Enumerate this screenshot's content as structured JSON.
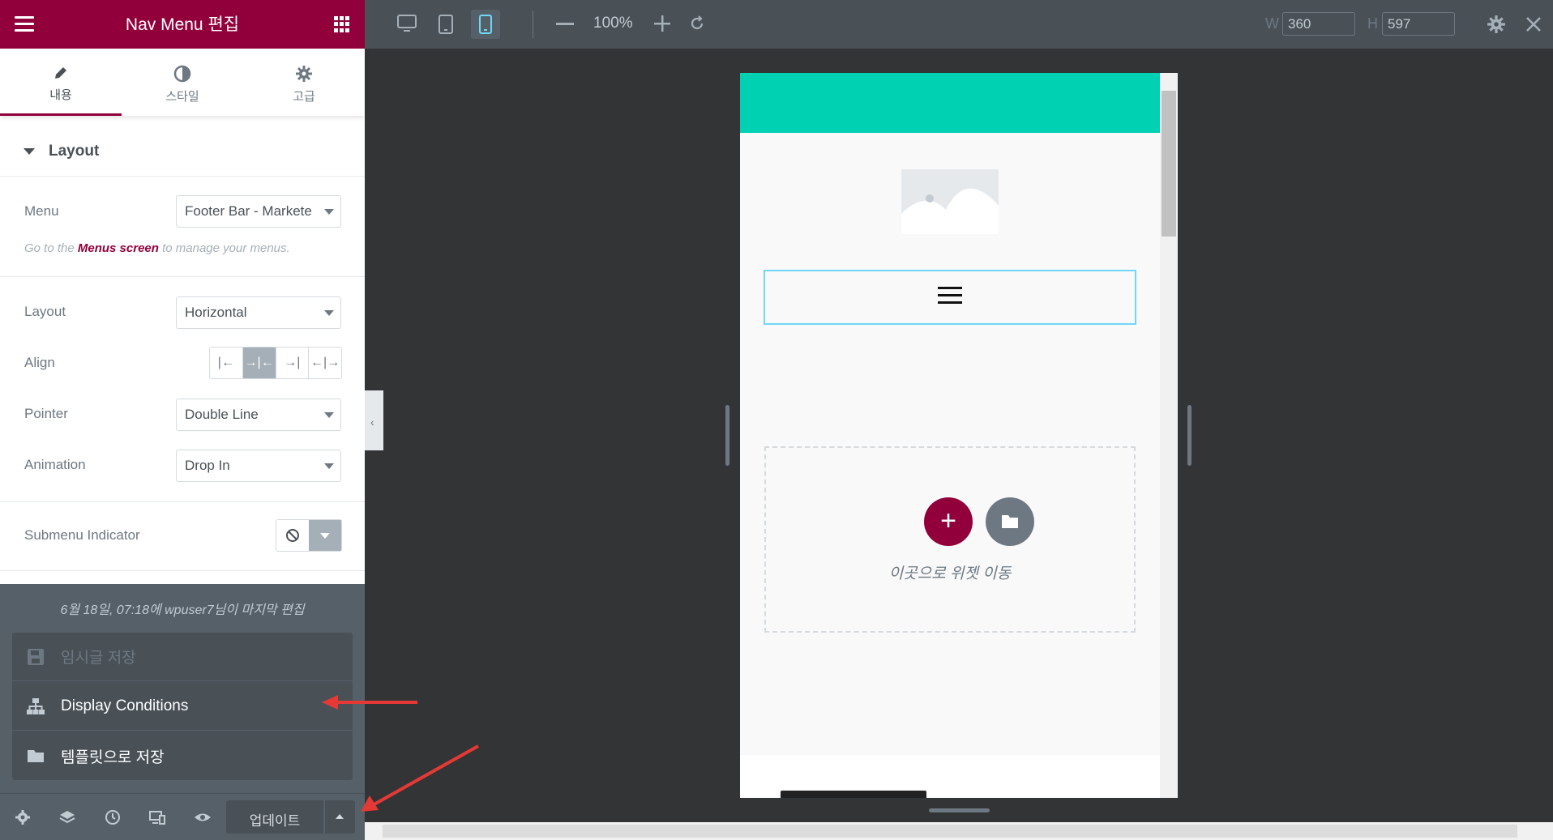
{
  "header": {
    "title": "Nav Menu 편집"
  },
  "tabs": [
    {
      "label": "내용",
      "icon": "pencil-icon",
      "active": true
    },
    {
      "label": "스타일",
      "icon": "half-circle-icon",
      "active": false
    },
    {
      "label": "고급",
      "icon": "gear-icon",
      "active": false
    }
  ],
  "section": {
    "title": "Layout"
  },
  "controls": {
    "menu": {
      "label": "Menu",
      "value": "Footer Bar - Markete"
    },
    "note": {
      "prefix": "Go to the ",
      "link": "Menus screen",
      "suffix": " to manage your menus."
    },
    "layout": {
      "label": "Layout",
      "value": "Horizontal"
    },
    "align": {
      "label": "Align",
      "options": [
        "left",
        "center",
        "right",
        "justify"
      ],
      "selected": "center"
    },
    "pointer": {
      "label": "Pointer",
      "value": "Double Line"
    },
    "animation": {
      "label": "Animation",
      "value": "Drop In"
    },
    "submenu": {
      "label": "Submenu Indicator"
    }
  },
  "popup": {
    "meta": "6월 18일, 07:18에 wpuser7님이 마지막 편집",
    "items": [
      {
        "label": "임시글 저장",
        "icon": "save-icon",
        "disabled": true
      },
      {
        "label": "Display Conditions",
        "icon": "sitemap-icon",
        "disabled": false
      },
      {
        "label": "템플릿으로 저장",
        "icon": "folder-icon",
        "disabled": false
      }
    ]
  },
  "footer": {
    "update_label": "업데이트"
  },
  "topbar": {
    "zoom": "100%",
    "w_label": "W",
    "w_value": "360",
    "h_label": "H",
    "h_value": "597",
    "active_device": "mobile"
  },
  "canvas": {
    "drop_text": "이곳으로 위젯 이동"
  },
  "colors": {
    "brand": "#92003b",
    "teal": "#00d1b2",
    "panel_dark": "#556068",
    "annotation_arrow": "#e53935"
  }
}
